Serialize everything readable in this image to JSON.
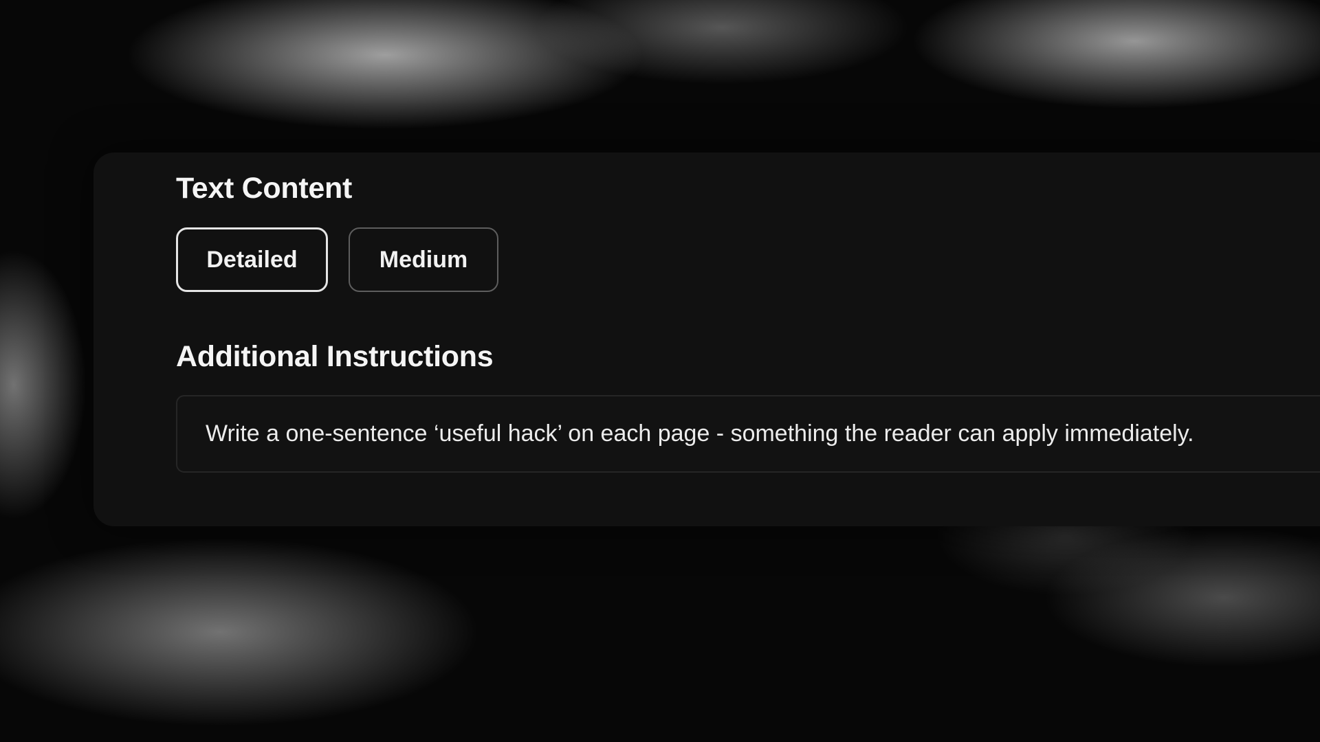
{
  "text_content": {
    "title": "Text Content",
    "options": [
      {
        "label": "Detailed",
        "selected": true
      },
      {
        "label": "Medium",
        "selected": false
      }
    ]
  },
  "additional_instructions": {
    "title": "Additional Instructions",
    "value": "Write a one-sentence ‘useful hack’ on each page - something the reader can apply immediately."
  },
  "colors": {
    "panel_background": "#111111",
    "selected_border": "#e6e6e6",
    "unselected_border": "#5e5e5e",
    "text": "#f5f5f5"
  }
}
